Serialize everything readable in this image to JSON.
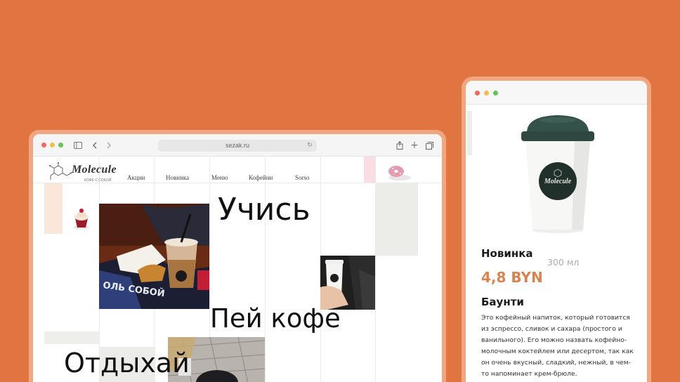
{
  "desktop": {
    "address": "sezak.ru",
    "logo": {
      "name": "Molecule",
      "tagline": "КОФЕ С СОБОЙ"
    },
    "nav": [
      "Акции",
      "Новинка",
      "Меню",
      "Кофейни",
      "Sorso"
    ],
    "headlines": {
      "learn": "Учись",
      "drink": "Пей кофе",
      "rest": "Отдыхай"
    },
    "photos": {
      "main": "cafe-table-drinks",
      "hand": "hand-holding-cup",
      "street": "street-paving"
    }
  },
  "mobile": {
    "product": {
      "badge": "Новинка",
      "volume": "300 мл",
      "price": "4,8 BYN",
      "name": "Баунти",
      "cup_logo": "Molecule",
      "description": "Это кофейный напиток, который готовится из эспрессо, сливок и сахара (простого и ванильного). Его можно назвать кофейно-молочным коктейлем или десертом, так как он очень вкусный, сладкий, нежный, в чем-то напоминает крем-брюле."
    }
  },
  "colors": {
    "background": "#E07542",
    "frame": "#F2A680",
    "price": "#D9834F",
    "cup_lid": "#2F4A43"
  },
  "icons": [
    "sidebar-icon",
    "back-icon",
    "forward-icon",
    "reload-icon",
    "share-icon",
    "new-tab-icon",
    "tabs-icon"
  ]
}
